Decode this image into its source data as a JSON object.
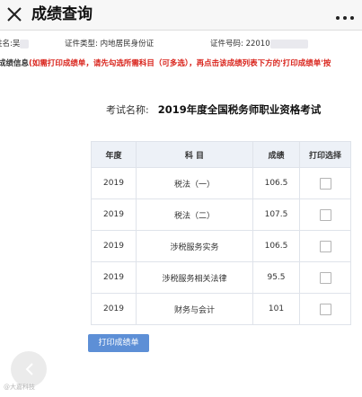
{
  "app": {
    "title": "成绩查询"
  },
  "info": {
    "name_label": "姓名:",
    "name_value": "吴",
    "id_type_label": "证件类型:",
    "id_type_value": "内地居民身份证",
    "id_number_label": "证件号码:",
    "id_number_value": "22010"
  },
  "notice": {
    "heading": "成绩信息",
    "instruction": "(如需打印成绩单，请先勾选所需科目（可多选），再点击该成绩列表下方的'打印成绩单'按"
  },
  "exam": {
    "label": "考试名称:",
    "name": "2019年度全国税务师职业资格考试"
  },
  "table": {
    "headers": {
      "year": "年度",
      "subject": "科 目",
      "score": "成绩",
      "print": "打印选择"
    },
    "rows": [
      {
        "year": "2019",
        "subject": "税法（一）",
        "score": "106.5",
        "checked": false
      },
      {
        "year": "2019",
        "subject": "税法（二）",
        "score": "107.5",
        "checked": false
      },
      {
        "year": "2019",
        "subject": "涉税服务实务",
        "score": "106.5",
        "checked": false
      },
      {
        "year": "2019",
        "subject": "涉税服务相关法律",
        "score": "95.5",
        "checked": false
      },
      {
        "year": "2019",
        "subject": "财务与会计",
        "score": "101",
        "checked": false
      }
    ]
  },
  "actions": {
    "print_label": "打印成绩单"
  },
  "icons": {
    "close": "close-icon",
    "more": "more-icon",
    "back": "chevron-left-icon"
  },
  "colors": {
    "accent": "#5d8fd6",
    "warning": "#d9231b",
    "table_header": "#edf1f7"
  },
  "watermark": "@大嘉科技"
}
